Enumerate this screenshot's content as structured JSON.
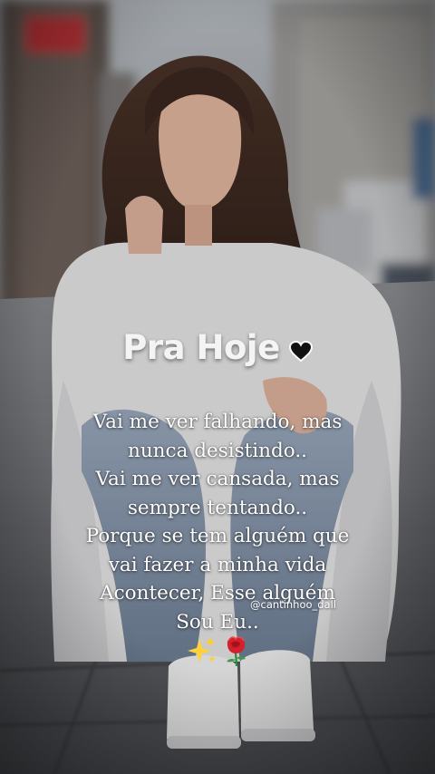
{
  "photo": {
    "subject": "woman-crouching-on-street-photo"
  },
  "title": {
    "text": "Pra Hoje",
    "icon": "black-heart-icon"
  },
  "message": {
    "lines": [
      "Vai me ver falhando, mas",
      "nunca desistindo..",
      "Vai me ver cansada, mas",
      "sempre tentando..",
      "Porque se tem alguém que",
      "vai fazer a minha vida",
      "Acontecer, Esse alguém",
      "Sou Eu.."
    ]
  },
  "watermark": {
    "handle": "@cantinhoo_dall"
  },
  "decorations": {
    "icons": [
      "sparkles-icon",
      "rose-icon"
    ]
  }
}
